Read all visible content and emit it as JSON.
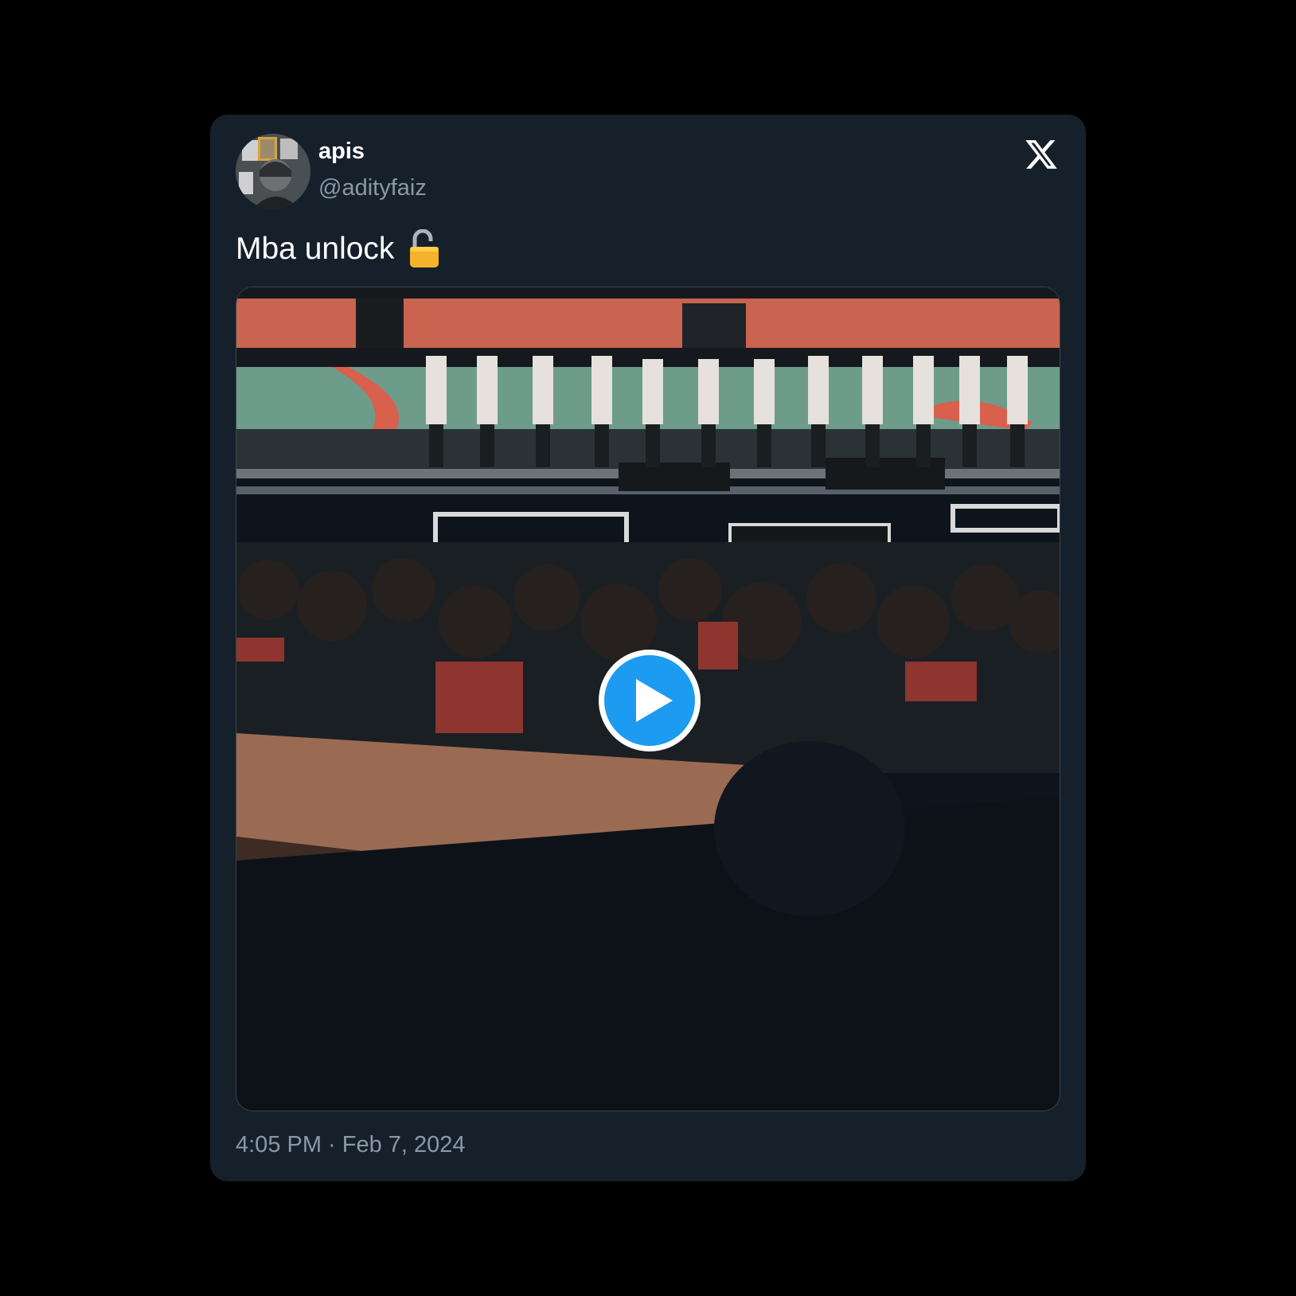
{
  "tweet": {
    "author_name": "apis",
    "author_handle": "@adityfaiz",
    "text": "Mba unlock",
    "emoji_icon": "unlocked-padlock-icon",
    "timestamp": "4:05 PM · Feb 7, 2024"
  },
  "media": {
    "type": "video",
    "play_icon": "play-icon"
  },
  "brand": {
    "logo_icon": "x-logo-icon"
  },
  "colors": {
    "page_background": "#000000",
    "card_background": "#15202b",
    "primary_text": "#ffffff",
    "secondary_text": "#8b98a5",
    "play_button": "#1d9bf0"
  }
}
